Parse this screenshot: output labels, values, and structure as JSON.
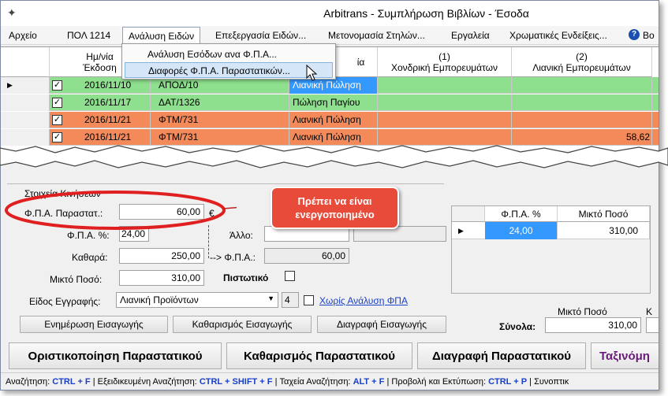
{
  "window": {
    "title": "Arbitrans - Συμπλήρωση Βιβλίων - Έσοδα"
  },
  "menu": {
    "items": [
      "Αρχείο",
      "ΠΟΛ 1214",
      "Ανάλυση Ειδών",
      "Επεξεργασία Ειδών...",
      "Μετονομασία Στηλών...",
      "Εργαλεία",
      "Χρωματικές Ενδείξεις...",
      "Βο"
    ],
    "dropdown": [
      "Ανάλυση Εσόδων ανα Φ.Π.Α...",
      "Διαφορές Φ.Π.Α. Παραστατικών..."
    ]
  },
  "grid": {
    "headers": {
      "date": [
        "Ημ/νία",
        "Έκδοση"
      ],
      "type": "ία",
      "col1": [
        "(1)",
        "Χονδρική Εμπορευμάτων"
      ],
      "col2": [
        "(2)",
        "Λιανική Εμπορευμάτων"
      ]
    },
    "rows": [
      {
        "date": "2016/11/10",
        "doc": "ΑΠΟΔ/10",
        "kind": "Λιανική Πώληση",
        "col1": "",
        "col2": "",
        "color": "#8ee08e"
      },
      {
        "date": "2016/11/17",
        "doc": "ΔΑΤ/1326",
        "kind": "Πώληση Παγίου",
        "col1": "",
        "col2": "",
        "color": "#8ee08e"
      },
      {
        "date": "2016/11/21",
        "doc": "ΦΤΜ/731",
        "kind": "Λιανική Πώληση",
        "col1": "",
        "col2": "",
        "color": "#f48a5a"
      },
      {
        "date": "2016/11/21",
        "doc": "ΦΤΜ/731",
        "kind": "Λιανική Πώληση",
        "col1": "",
        "col2": "58,62",
        "color": "#f48a5a"
      }
    ]
  },
  "form": {
    "section_label": "Στοιχεία Κινήσεων",
    "vat_diff_label": "Φ.Π.Α. Παραστατ.:",
    "vat_diff_value": "60,00",
    "currency": "€",
    "vat_pct_label": "Φ.Π.Α. %:",
    "vat_pct_value": "24,00",
    "net_label": "Καθαρά:",
    "net_value": "250,00",
    "gross_label": "Μικτό Ποσό:",
    "gross_value": "310,00",
    "other_label": "Άλλο:",
    "arrow_vat_label": "--> Φ.Π.Α.:",
    "arrow_vat_value": "60,00",
    "credit_label": "Πιστωτικό",
    "entry_type_label": "Είδος Εγγραφής:",
    "entry_type_value": "Λιανική Προϊόντων",
    "entry_type_code": "4",
    "no_vat_analysis_label": "Χωρίς Ανάλυση ΦΠΑ",
    "btn_update": "Ενημέρωση Εισαγωγής",
    "btn_clear": "Καθαρισμός Εισαγωγής",
    "btn_delete": "Διαγραφή Εισαγωγής"
  },
  "callout": {
    "line1": "Πρέπει να είναι",
    "line2": "ενεργοποιημένο"
  },
  "vat_grid": {
    "headers": [
      "Φ.Π.Α. %",
      "Μικτό Ποσό"
    ],
    "rows": [
      {
        "vat": "24,00",
        "gross": "310,00"
      }
    ]
  },
  "totals": {
    "header": "Μικτό Ποσό",
    "label": "Σύνολα:",
    "value": "310,00",
    "k_label": "Κ"
  },
  "actions": {
    "finalize": "Οριστικοποίηση Παραστατικού",
    "clear_doc": "Καθαρισμός Παραστατικού",
    "delete_doc": "Διαγραφή Παραστατικού",
    "sort": "Ταξινόμη"
  },
  "status": {
    "search_label": "Αναζήτηση:",
    "search_key": "CTRL + F",
    "adv_label": "Εξειδικευμένη Αναζήτηση:",
    "adv_key": "CTRL + SHIFT + F",
    "fast_label": "Ταχεία Αναζήτηση:",
    "fast_key": "ALT + F",
    "print_label": "Προβολή και Εκτύπωση:",
    "print_key": "CTRL + P",
    "more_label": "Συνοπτικ"
  },
  "colors": {
    "green_row": "#8ee08e",
    "orange_row": "#f48a5a",
    "selection": "#3399ff",
    "callout": "#e84b3a",
    "ellipse": "#e02020"
  }
}
